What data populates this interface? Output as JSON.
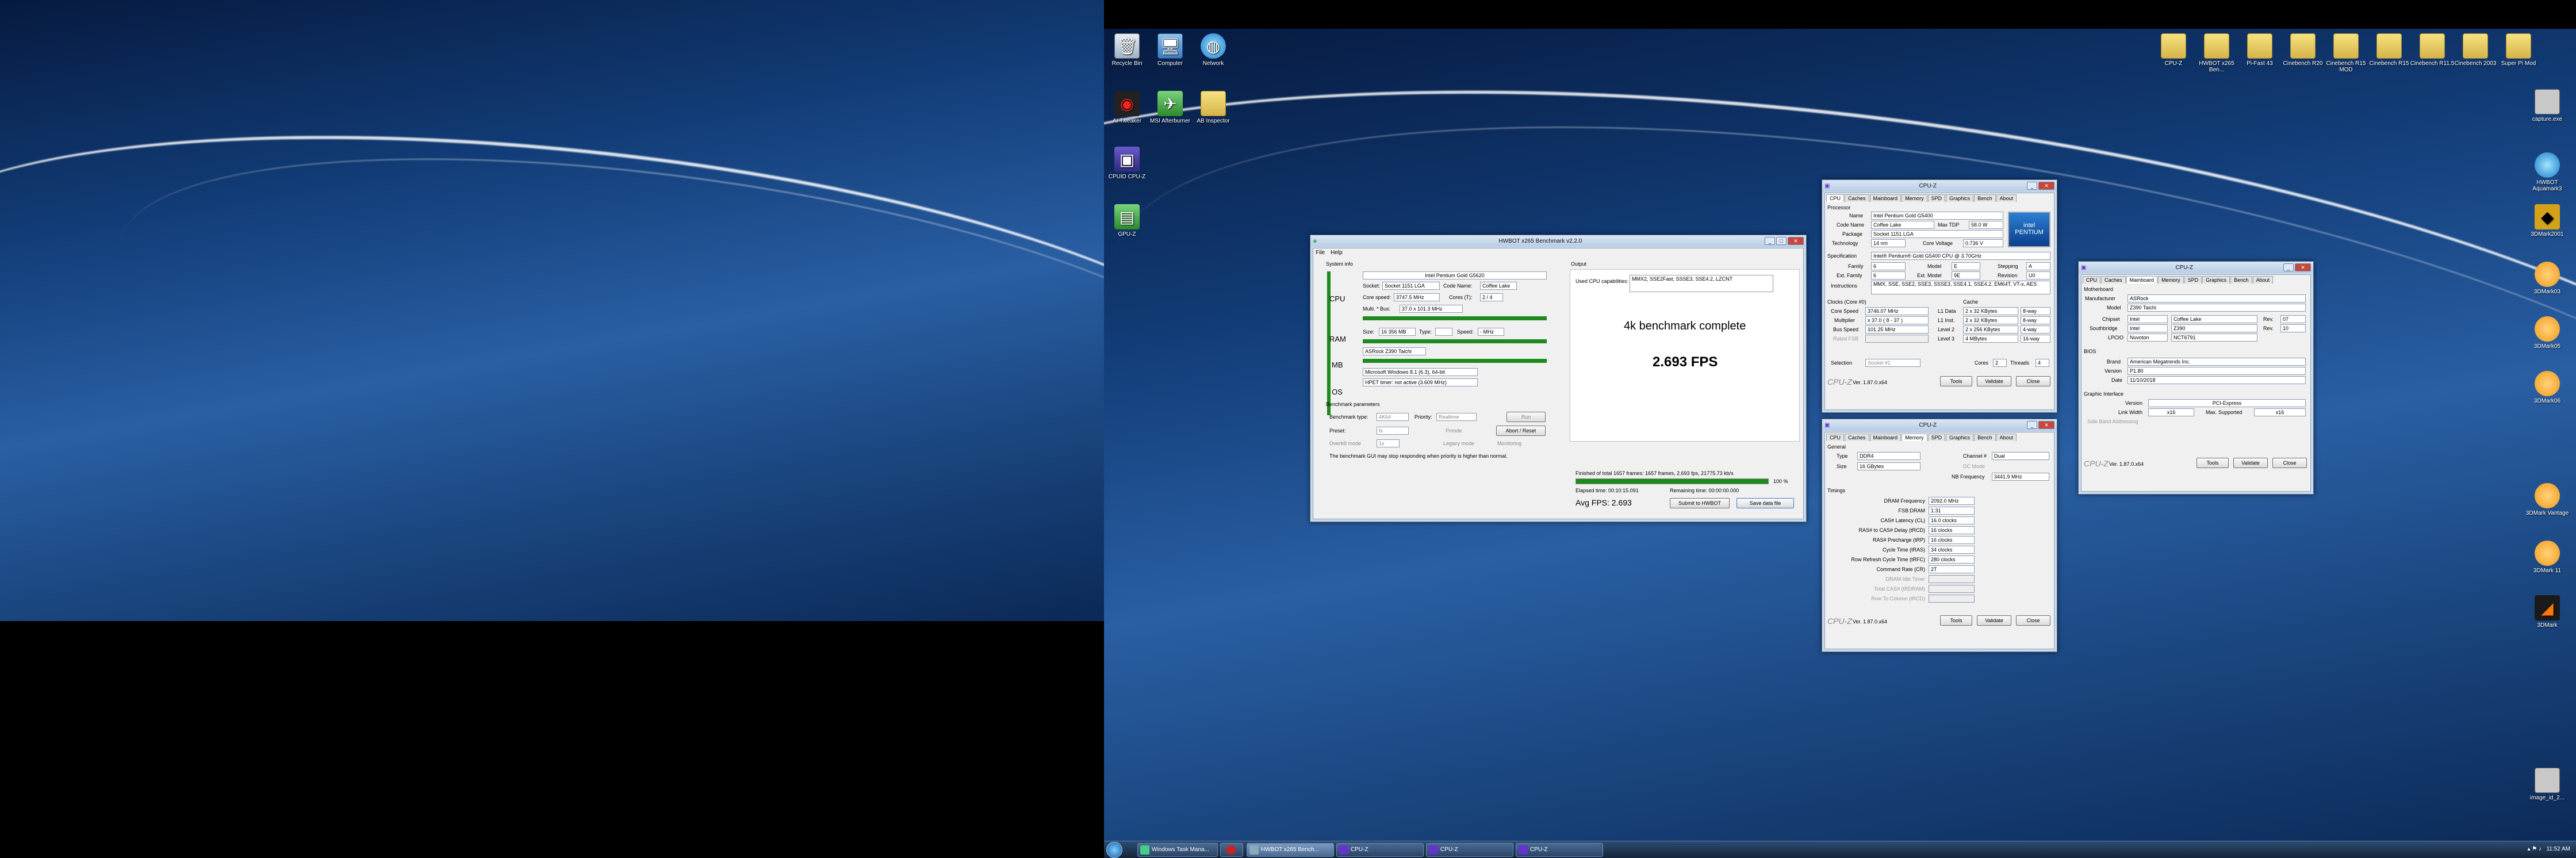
{
  "desktop_left": {
    "icons": []
  },
  "desktop_right": {
    "icons_left": [
      {
        "label": "Recycle Bin",
        "icon": "recycle-bin-icon"
      },
      {
        "label": "Computer",
        "icon": "computer-icon"
      },
      {
        "label": "Network",
        "icon": "network-icon"
      },
      {
        "label": "AI Tweaker",
        "icon": "ai-tweaker-icon"
      },
      {
        "label": "MSI Afterburner",
        "icon": "msi-afterburner-icon"
      },
      {
        "label": "AB Inspector",
        "icon": "folder-icon"
      },
      {
        "label": "CPUID CPU-Z",
        "icon": "cpuz-icon"
      },
      {
        "label": "GPU-Z",
        "icon": "gpuz-icon"
      }
    ],
    "icons_top_right": [
      {
        "label": "CPU-Z"
      },
      {
        "label": "HWBOT x265 Ben..."
      },
      {
        "label": "Pi-Fast 43"
      },
      {
        "label": "Cinebench R20"
      },
      {
        "label": "Cinebench R15 MOD"
      },
      {
        "label": "Cinebench R15"
      },
      {
        "label": "Cinebench R11.5"
      },
      {
        "label": "Cinebench 2003"
      },
      {
        "label": "Super Pi Mod"
      }
    ],
    "icons_right_col": [
      {
        "label": "capture.exe"
      },
      {
        "label": "HWBOT Aquamark3"
      },
      {
        "label": "3DMark2001"
      },
      {
        "label": "3DMark03"
      },
      {
        "label": "3DMark05"
      },
      {
        "label": "3DMark06"
      },
      {
        "label": "3DMark Vantage"
      },
      {
        "label": "3DMark 11"
      },
      {
        "label": "3DMark"
      },
      {
        "label": "image_id_2..."
      }
    ]
  },
  "hwbot": {
    "title": "HWBOT x265 Benchmark v2.2.0",
    "menu": [
      "File",
      "Help"
    ],
    "system_info_label": "System info",
    "row_labels": [
      "CPU",
      "RAM",
      "MB",
      "OS"
    ],
    "cpu_name": "Intel Pentium Gold G5620",
    "socket_label": "Socket:",
    "socket": "Socket 1151 LGA",
    "codename_label": "Code Name:",
    "codename": "Coffee Lake",
    "core_speed_label": "Core speed:",
    "core_speed": "3747.5 MHz",
    "cores_label": "Cores (T):",
    "cores": "2 / 4",
    "multi_label": "Multi. * Bus:",
    "multi": "37.0 x 101.3 MHz",
    "ram_size_label": "Size:",
    "ram_size": "16 356 MB",
    "type_label": "Type:",
    "type": "",
    "speed_label": "Speed:",
    "speed": "- MHz",
    "mb": "ASRock Z390 Taichi",
    "os": "Microsoft Windows 8.1 (6.3), 64-bit",
    "hpet": "HPET timer: not active (3.609 MHz)",
    "bench_params_label": "Benchmark parameters",
    "bench_type_label": "Benchmark type:",
    "bench_type": "4K64",
    "priority_label": "Priority:",
    "priority": "Realtime",
    "run_label": "Run",
    "preset_label": "Preset:",
    "preset": "fx",
    "pmode_label": "Pmode",
    "abort_label": "Abort / Reset",
    "overkill_label": "Overkill mode",
    "overkill_val": "1x",
    "legacy_label": "Legacy mode",
    "monitoring_label": "Monitoring",
    "note": "The benchmark GUI may stop responding when priority is higher than normal.",
    "output_label": "Output",
    "caps_label": "Used CPU capabilities:",
    "caps": "MMX2, SSE2Fast, SSSE3, SSE4.2, LZCNT",
    "status": "4k benchmark complete",
    "fps": "2.693 FPS",
    "finished": "Finished of total 1657 frames: 1657 frames, 2.693 fps, 21775.73 kb/s",
    "progress_pct": 100,
    "progress_label": "100 %",
    "elapsed": "Elapsed time: 00:10:15.091",
    "remaining": "Remaining time: 00:00:00.000",
    "avg_fps": "Avg FPS: 2.693",
    "submit_label": "Submit to HWBOT",
    "save_label": "Save data file"
  },
  "cpuz_cpu": {
    "title": "CPU-Z",
    "tabs": [
      "CPU",
      "Caches",
      "Mainboard",
      "Memory",
      "SPD",
      "Graphics",
      "Bench",
      "About"
    ],
    "processor_label": "Processor",
    "name_label": "Name",
    "name": "Intel Pentium Gold G5400",
    "codename_label": "Code Name",
    "codename": "Coffee Lake",
    "maxtdp_label": "Max TDP",
    "maxtdp": "58.0 W",
    "package_label": "Package",
    "package": "Socket 1151 LGA",
    "tech_label": "Technology",
    "tech": "14 nm",
    "voltage_label": "Core Voltage",
    "voltage": "0.736 V",
    "spec_label": "Specification",
    "spec": "Intel® Pentium® Gold G5400 CPU @ 3.70GHz",
    "family_label": "Family",
    "family": "6",
    "model_label": "Model",
    "model": "E",
    "stepping_label": "Stepping",
    "stepping": "A",
    "extfam_label": "Ext. Family",
    "extfam": "6",
    "extmodel_label": "Ext. Model",
    "extmodel": "9E",
    "rev_label": "Revision",
    "rev": "U0",
    "instr_label": "Instructions",
    "instr": "MMX, SSE, SSE2, SSE3, SSSE3, SSE4.1, SSE4.2, EM64T, VT-x, AES",
    "clocks_label": "Clocks (Core #0)",
    "cache_label": "Cache",
    "corespeed_label": "Core Speed",
    "corespeed": "3746.07 MHz",
    "l1d_label": "L1 Data",
    "l1d": "2 x 32 KBytes",
    "l1d_w": "8-way",
    "mult_label": "Multiplier",
    "mult": "x 37.0 ( 8 - 37 )",
    "l1i_label": "L1 Inst.",
    "l1i": "2 x 32 KBytes",
    "l1i_w": "8-way",
    "bus_label": "Bus Speed",
    "bus": "101.25 MHz",
    "l2_label": "Level 2",
    "l2": "2 x 256 KBytes",
    "l2_w": "4-way",
    "fsb_label": "Rated FSB",
    "l3_label": "Level 3",
    "l3": "4 MBytes",
    "l3_w": "16-way",
    "selection_label": "Selection",
    "selection": "Socket #1",
    "cores_label": "Cores",
    "cores": "2",
    "threads_label": "Threads",
    "threads": "4",
    "brand": "CPU-Z",
    "version": "Ver. 1.87.0.x64",
    "tools_label": "Tools",
    "validate_label": "Validate",
    "close_label": "Close"
  },
  "cpuz_mem": {
    "title": "CPU-Z",
    "tabs": [
      "CPU",
      "Caches",
      "Mainboard",
      "Memory",
      "SPD",
      "Graphics",
      "Bench",
      "About"
    ],
    "general_label": "General",
    "type_label": "Type",
    "type": "DDR4",
    "channel_label": "Channel #",
    "channel": "Dual",
    "size_label": "Size",
    "size": "16 GBytes",
    "dcmode_label": "DC Mode",
    "nbfreq_label": "NB Frequency",
    "nbfreq": "3441.9 MHz",
    "timings_label": "Timings",
    "timings": [
      {
        "label": "DRAM Frequency",
        "value": "2092.0 MHz"
      },
      {
        "label": "FSB:DRAM",
        "value": "1:31"
      },
      {
        "label": "CAS# Latency (CL)",
        "value": "16.0 clocks"
      },
      {
        "label": "RAS# to CAS# Delay (tRCD)",
        "value": "16 clocks"
      },
      {
        "label": "RAS# Precharge (tRP)",
        "value": "16 clocks"
      },
      {
        "label": "Cycle Time (tRAS)",
        "value": "34 clocks"
      },
      {
        "label": "Row Refresh Cycle Time (tRFC)",
        "value": "280 clocks"
      },
      {
        "label": "Command Rate (CR)",
        "value": "2T"
      },
      {
        "label": "DRAM Idle Timer",
        "value": ""
      },
      {
        "label": "Total CAS# (tRDRAM)",
        "value": ""
      },
      {
        "label": "Row To Column (tRCD)",
        "value": ""
      }
    ],
    "brand": "CPU-Z",
    "version": "Ver. 1.87.0.x64",
    "tools_label": "Tools",
    "validate_label": "Validate",
    "close_label": "Close"
  },
  "cpuz_mb": {
    "title": "CPU-Z",
    "tabs": [
      "CPU",
      "Caches",
      "Mainboard",
      "Memory",
      "SPD",
      "Graphics",
      "Bench",
      "About"
    ],
    "mb_label": "Motherboard",
    "manu_label": "Manufacturer",
    "manu": "ASRock",
    "model_label": "Model",
    "model": "Z390 Taichi",
    "chipset_label": "Chipset",
    "chipset": "Intel",
    "chipset2": "Coffee Lake",
    "chipset_rev_label": "Rev.",
    "chipset_rev": "07",
    "south_label": "Southbridge",
    "south": "Intel",
    "south2": "Z390",
    "south_rev_label": "Rev.",
    "south_rev": "10",
    "lpcio_label": "LPCIO",
    "lpcio": "Nuvoton",
    "lpcio2": "NCT6791",
    "bios_label": "BIOS",
    "brand_label": "Brand",
    "bios_brand": "American Megatrends Inc.",
    "version_label": "Version",
    "bios_version": "P1.80",
    "date_label": "Date",
    "bios_date": "11/10/2018",
    "gi_label": "Graphic Interface",
    "giver_label": "Version",
    "giver": "PCI-Express",
    "linkw_label": "Link Width",
    "linkw": "x16",
    "maxsup_label": "Max. Supported",
    "maxsup": "x16",
    "sideband_label": "Side Band Addressing",
    "brand": "CPU-Z",
    "version": "Ver. 1.87.0.x64",
    "tools_label": "Tools",
    "validate_label": "Validate",
    "close_label": "Close"
  },
  "taskbar": {
    "buttons": [
      {
        "label": "Windows Task Mana..."
      },
      {
        "label": ""
      },
      {
        "label": "HWBOT x265 Bench..."
      },
      {
        "label": "CPU-Z"
      },
      {
        "label": "CPU-Z"
      },
      {
        "label": "CPU-Z"
      }
    ],
    "clock": "11:52 AM"
  },
  "colors": {
    "accent_green": "#1c8a1c",
    "title_blue": "#b9cde5",
    "desktop_blue": "#2a5fa3"
  }
}
